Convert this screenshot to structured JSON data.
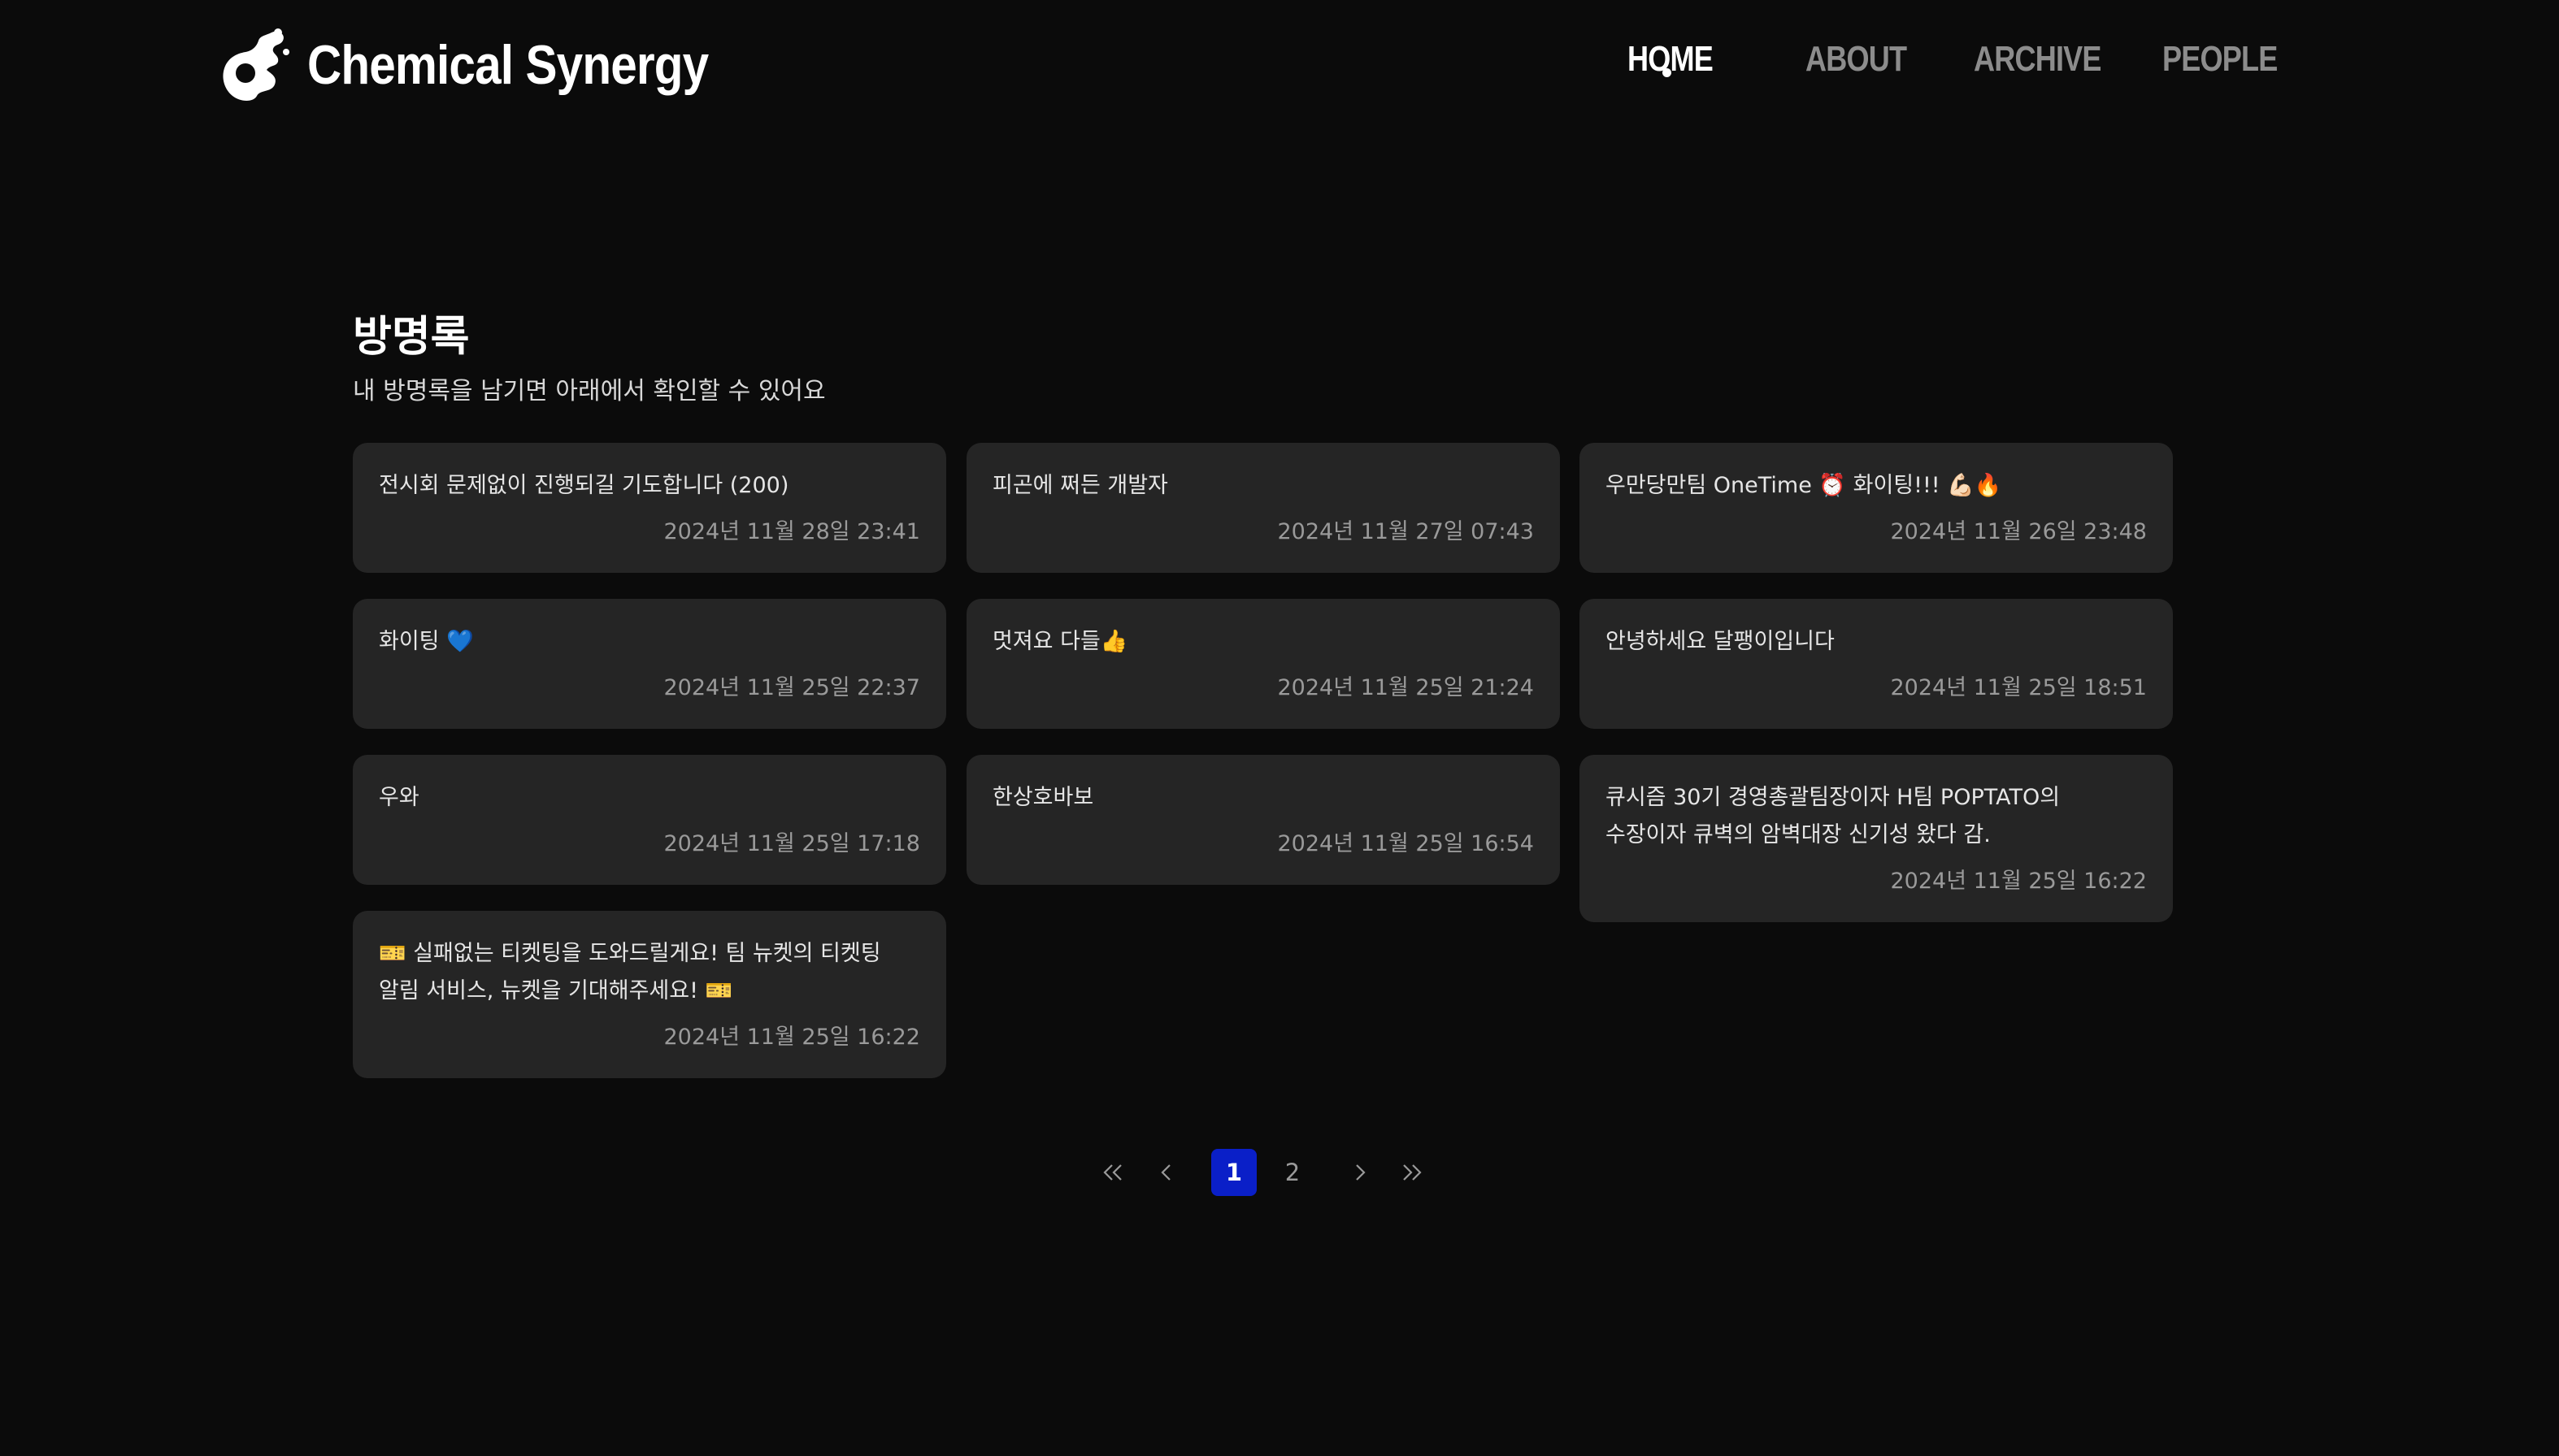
{
  "header": {
    "logo_text": "Chemical Synergy",
    "nav": [
      {
        "label": "HOME",
        "active": true
      },
      {
        "label": "ABOUT",
        "active": false
      },
      {
        "label": "ARCHIVE",
        "active": false
      },
      {
        "label": "PEOPLE",
        "active": false
      }
    ]
  },
  "guestbook": {
    "title": "방명록",
    "subtitle": "내 방명록을 남기면 아래에서 확인할 수 있어요",
    "entries": [
      {
        "message": "전시회 문제없이 진행되길 기도합니다 (200)",
        "date": "2024년 11월 28일 23:41"
      },
      {
        "message": "피곤에 쩌든 개발자",
        "date": "2024년 11월 27일 07:43"
      },
      {
        "message": "우만당만팀 OneTime ⏰ 화이팅!!! 💪🏻🔥",
        "date": "2024년 11월 26일 23:48"
      },
      {
        "message": "화이팅 💙",
        "date": "2024년 11월 25일 22:37"
      },
      {
        "message": "멋져요 다들👍",
        "date": "2024년 11월 25일 21:24"
      },
      {
        "message": "안녕하세요 달팽이입니다",
        "date": "2024년 11월 25일 18:51"
      },
      {
        "message": "우와",
        "date": "2024년 11월 25일 17:18"
      },
      {
        "message": "한상호바보",
        "date": "2024년 11월 25일 16:54"
      },
      {
        "message": "큐시즘 30기 경영총괄팀장이자 H팀 POPTATO의 수장이자 큐벽의 암벽대장 신기성 왔다 감.",
        "date": "2024년 11월 25일 16:22"
      },
      {
        "message": "🎫 실패없는 티켓팅을 도와드릴게요! 팀 뉴켓의 티켓팅 알림 서비스, 뉴켓을 기대해주세요! 🎫",
        "date": "2024년 11월 25일 16:22"
      }
    ]
  },
  "pagination": {
    "first_icon": "double-chevron-left-icon",
    "prev_icon": "chevron-left-icon",
    "pages": [
      "1",
      "2"
    ],
    "current_page": "1",
    "next_icon": "chevron-right-icon",
    "last_icon": "double-chevron-right-icon",
    "accent_color": "#0a1fc8"
  }
}
